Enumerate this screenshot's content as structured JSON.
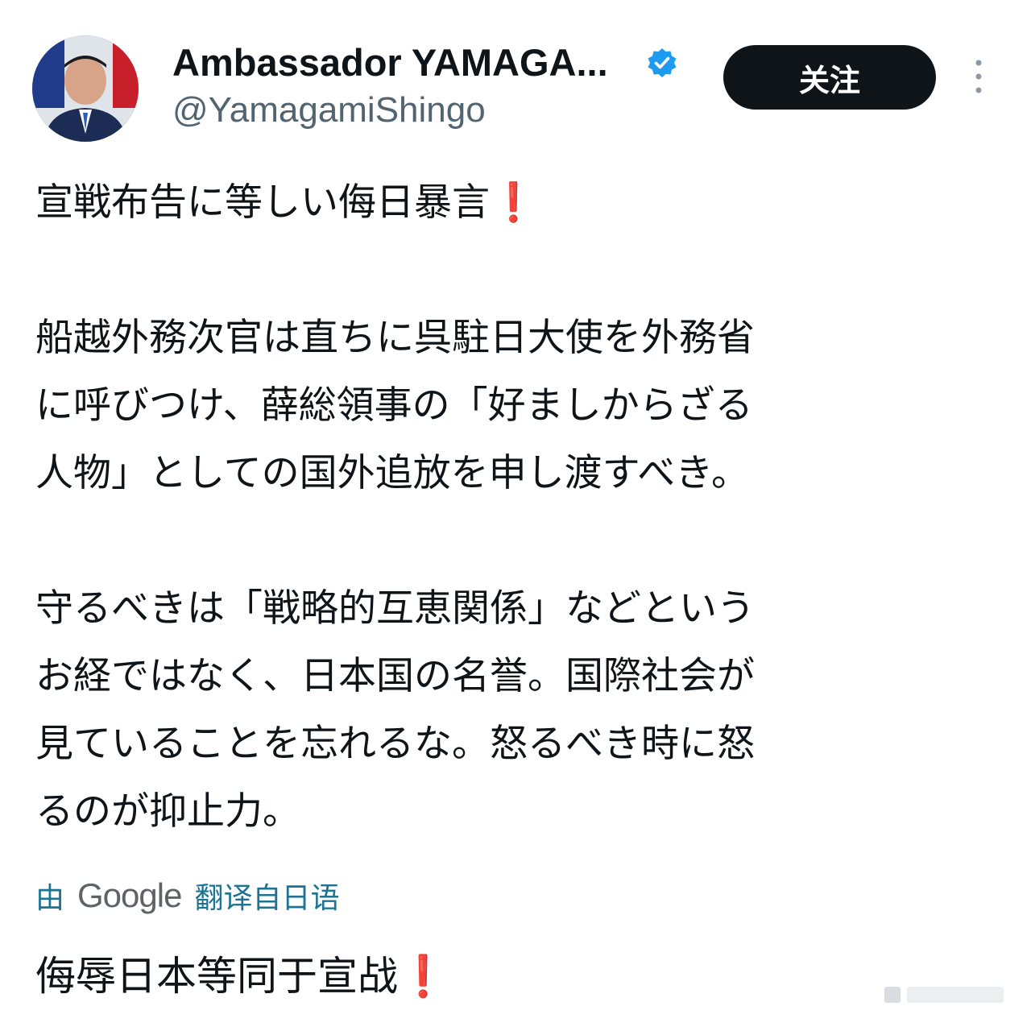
{
  "account": {
    "display_name": "Ambassador YAMAGA...",
    "handle": "@YamagamiShingo",
    "verified": true,
    "avatar_icon": "ambassador-portrait"
  },
  "follow_button": {
    "label": "关注"
  },
  "tweet": {
    "headline": "宣戦布告に等しい侮日暴言",
    "headline_emoji": "❗",
    "paragraph2_lines": [
      "船越外務次官は直ちに呉駐日大使を外務省",
      "に呼びつけ、薛総領事の「好ましからざる",
      "人物」としての国外追放を申し渡すべき。"
    ],
    "paragraph3_lines": [
      "守るべきは「戦略的互恵関係」などという",
      "お経ではなく、日本国の名誉。国際社会が",
      "見ていることを忘れるな。怒るべき時に怒",
      "るのが抑止力。"
    ]
  },
  "translation": {
    "prefix": "由",
    "provider": "Google",
    "suffix": "翻译自日语",
    "text": "侮辱日本等同于宣战",
    "emoji": "❗"
  },
  "colors": {
    "text": "#0f1419",
    "handle": "#536471",
    "verified": "#1d9bf0",
    "button_bg": "#0f1419",
    "translate_link": "#1d7391",
    "emoji": "#d8202f"
  }
}
